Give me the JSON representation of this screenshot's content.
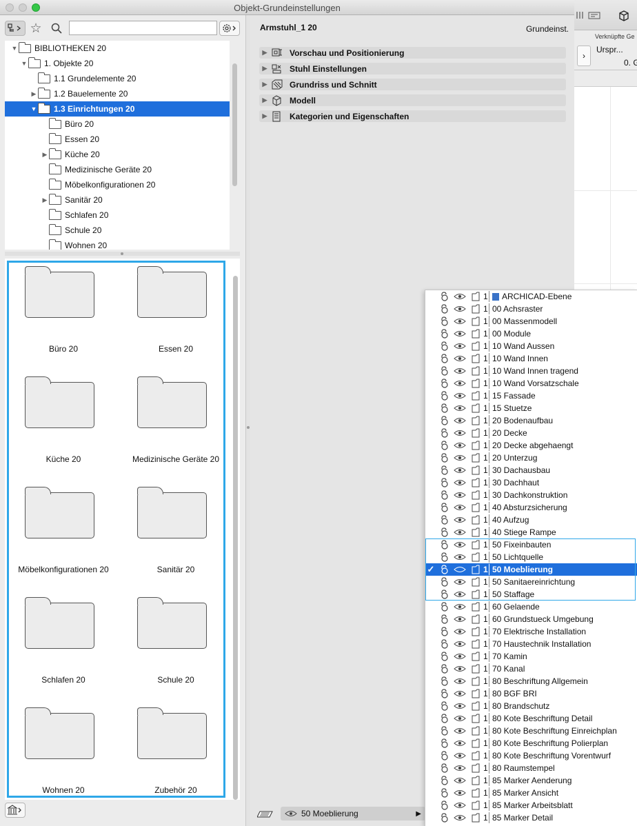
{
  "window": {
    "title": "Objekt-Grundeinstellungen"
  },
  "toolbar": {
    "search_value": "",
    "search_placeholder": ""
  },
  "tree": {
    "items": [
      {
        "label": "BIBLIOTHEKEN 20",
        "level": 1,
        "arrow": "▼"
      },
      {
        "label": "1. Objekte 20",
        "level": 2,
        "arrow": "▼"
      },
      {
        "label": "1.1 Grundelemente 20",
        "level": 3,
        "arrow": ""
      },
      {
        "label": "1.2 Bauelemente 20",
        "level": 3,
        "arrow": "▶"
      },
      {
        "label": "1.3 Einrichtungen 20",
        "level": 3,
        "arrow": "▼",
        "selected": true
      },
      {
        "label": "Büro 20",
        "level": 4,
        "arrow": ""
      },
      {
        "label": "Essen 20",
        "level": 4,
        "arrow": ""
      },
      {
        "label": "Küche 20",
        "level": 4,
        "arrow": "▶"
      },
      {
        "label": "Medizinische Geräte 20",
        "level": 4,
        "arrow": ""
      },
      {
        "label": "Möbelkonfigurationen 20",
        "level": 4,
        "arrow": ""
      },
      {
        "label": "Sanitär 20",
        "level": 4,
        "arrow": "▶"
      },
      {
        "label": "Schlafen 20",
        "level": 4,
        "arrow": ""
      },
      {
        "label": "Schule 20",
        "level": 4,
        "arrow": ""
      },
      {
        "label": "Wohnen 20",
        "level": 4,
        "arrow": ""
      }
    ]
  },
  "grid": {
    "folders": [
      "Büro 20",
      "Essen 20",
      "Küche 20",
      "Medizinische Geräte 20",
      "Möbelkonfigurationen 20",
      "Sanitär 20",
      "Schlafen 20",
      "Schule 20",
      "Wohnen 20",
      "Zubehör 20"
    ]
  },
  "object": {
    "name": "Armstuhl_1 20",
    "mode": "Grundeinst."
  },
  "sections": [
    {
      "label": "Vorschau und Positionierung",
      "icon": "preview-position-icon"
    },
    {
      "label": "Stuhl Einstellungen",
      "icon": "chair-settings-icon"
    },
    {
      "label": "Grundriss und Schnitt",
      "icon": "floorplan-section-icon"
    },
    {
      "label": "Modell",
      "icon": "model-cube-icon"
    },
    {
      "label": "Kategorien und Eigenschaften",
      "icon": "categories-icon"
    }
  ],
  "bottombar": {
    "layer_label": "50 Moeblierung"
  },
  "bgapp": {
    "linked_label": "Verknüpfte Ge",
    "origin_label": "Urspr...",
    "value_label": "0. G"
  },
  "layers": {
    "selected": "50 Moeblierung",
    "items": [
      "ARCHICAD-Ebene",
      "00 Achsraster",
      "00 Massenmodell",
      "00 Module",
      "10 Wand Aussen",
      "10 Wand Innen",
      "10 Wand Innen tragend",
      "10 Wand Vorsatzschale",
      "15 Fassade",
      "15 Stuetze",
      "20 Bodenaufbau",
      "20 Decke",
      "20 Decke abgehaengt",
      "20 Unterzug",
      "30 Dachausbau",
      "30 Dachhaut",
      "30 Dachkonstruktion",
      "40 Absturzsicherung",
      "40 Aufzug",
      "40 Stiege Rampe",
      "50 Fixeinbauten",
      "50 Lichtquelle",
      "50 Moeblierung",
      "50 Sanitaereinrichtung",
      "50 Staffage",
      "60 Gelaende",
      "60 Grundstueck Umgebung",
      "70 Elektrische Installation",
      "70 Haustechnik Installation",
      "70 Kamin",
      "70 Kanal",
      "80 Beschriftung Allgemein",
      "80 BGF BRI",
      "80 Brandschutz",
      "80 Kote Beschriftung Detail",
      "80 Kote Beschriftung Einreichplan",
      "80 Kote Beschriftung Polierplan",
      "80 Kote Beschriftung Vorentwurf",
      "80 Raumstempel",
      "85 Marker Aenderung",
      "85 Marker Ansicht",
      "85 Marker Arbeitsblatt",
      "85 Marker Detail"
    ],
    "intersection_group": "1",
    "checkmark": "✓"
  }
}
